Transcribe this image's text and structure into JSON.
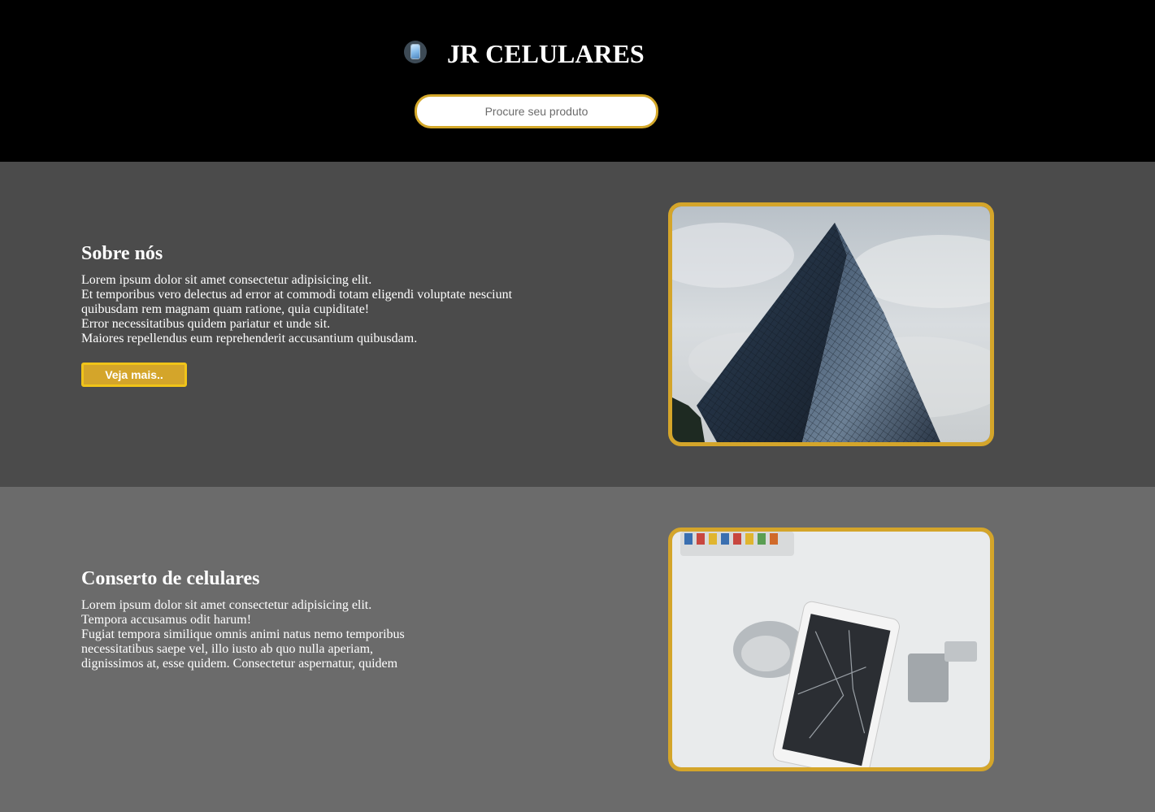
{
  "header": {
    "brand_icon": "mobile-phone-icon",
    "title": "JR CELULARES",
    "search": {
      "placeholder": "Procure seu produto",
      "value": ""
    }
  },
  "sections": [
    {
      "title": "Sobre nós",
      "lines": [
        "Lorem ipsum dolor sit amet consectetur adipisicing elit.",
        "Et temporibus vero delectus ad error at commodi totam eligendi voluptate nesciunt",
        "quibusdam rem magnam quam ratione, quia cupiditate!",
        "Error necessitatibus quidem pariatur et unde sit.",
        "Maiores repellendus eum reprehenderit accusantium quibusdam."
      ],
      "button_label": "Veja mais..",
      "image": "skyscraper-photo"
    },
    {
      "title": "Conserto de celulares",
      "lines": [
        "Lorem ipsum dolor sit amet consectetur adipisicing elit.",
        "Tempora accusamus odit harum!",
        "Fugiat tempora similique omnis animi natus nemo temporibus",
        "necessitatibus saepe vel, illo iusto ab quo nulla aperiam,",
        "dignissimos at, esse quidem. Consectetur aspernatur, quidem"
      ],
      "image": "phone-repair-photo"
    }
  ],
  "colors": {
    "header_bg": "#000000",
    "accent": "#d4a52a",
    "band_dark": "#4b4b4b",
    "band_light": "#6b6b6b"
  }
}
